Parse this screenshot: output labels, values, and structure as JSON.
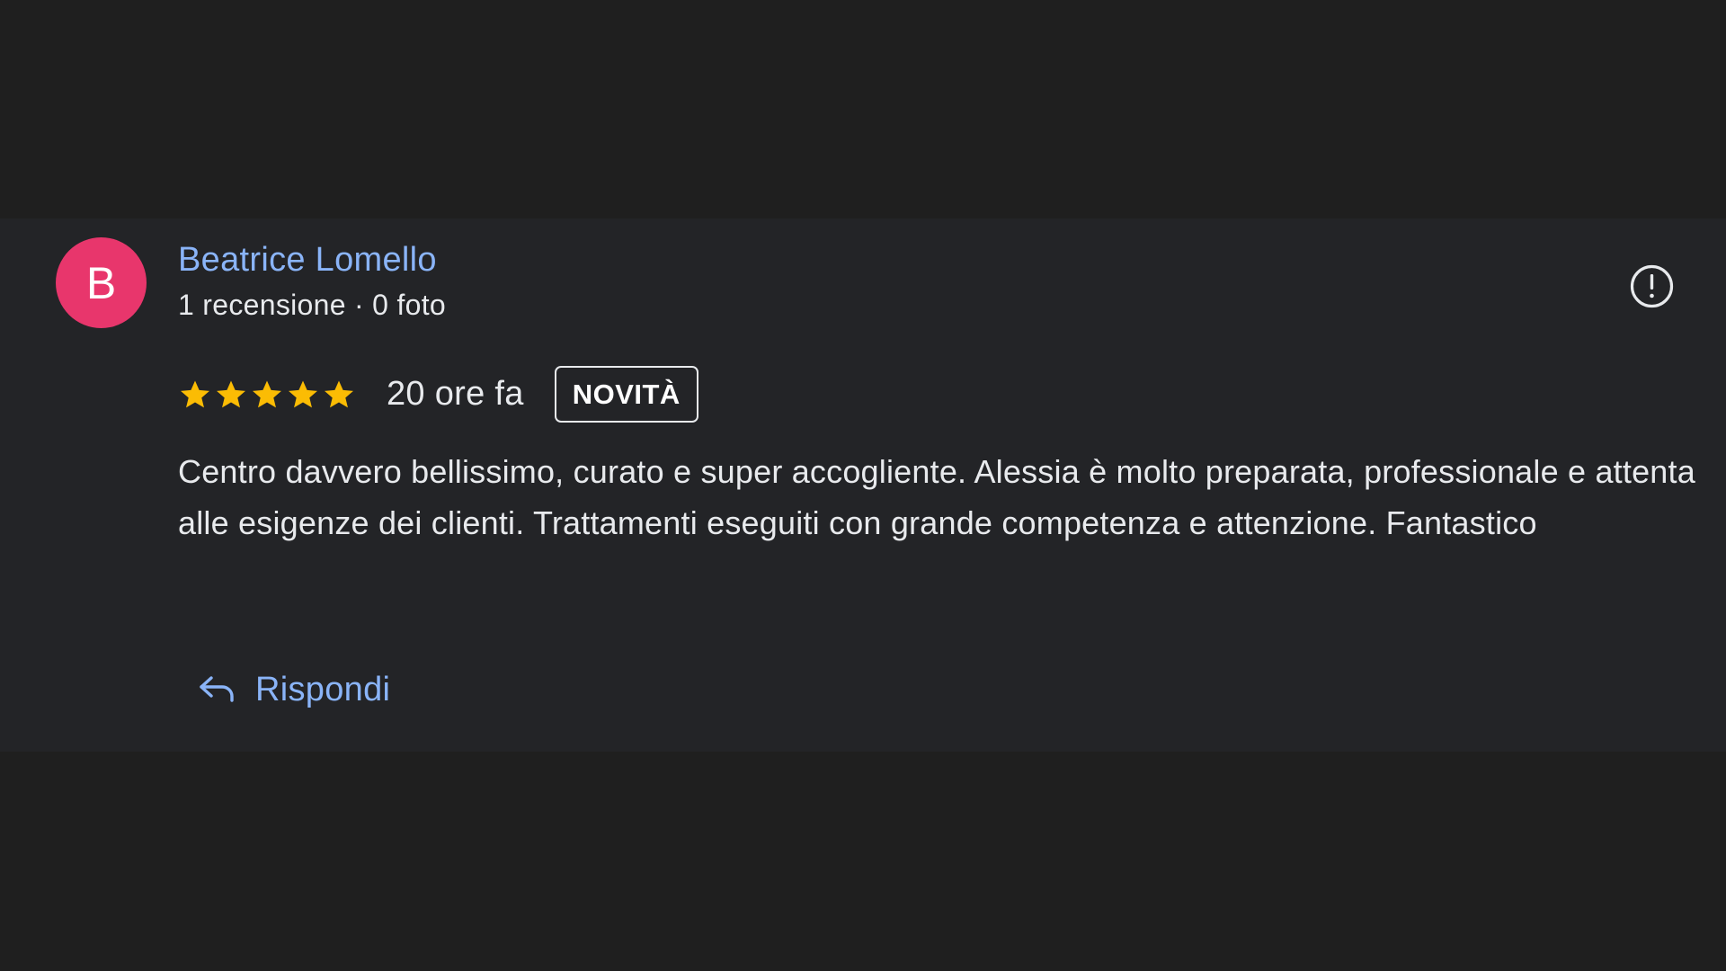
{
  "review": {
    "author": {
      "initial": "B",
      "name": "Beatrice Lomello",
      "meta": "1 recensione · 0 foto",
      "avatar_color": "#e8366c"
    },
    "rating": {
      "stars": 5,
      "max_stars": 5,
      "star_color": "#fbbc04"
    },
    "time_ago": "20 ore fa",
    "badge": "NOVITÀ",
    "text": "Centro davvero bellissimo, curato e super accogliente. Alessia è molto preparata, professionale e attenta alle esigenze dei clienti. Trattamenti eseguiti con grande competenza e attenzione. Fantastico",
    "report_icon": "report-icon",
    "reply": {
      "icon": "reply-icon",
      "label": "Rispondi"
    }
  },
  "colors": {
    "background": "#1f1f1f",
    "card": "#232427",
    "link": "#8ab4f8",
    "text": "#e8eaed"
  }
}
